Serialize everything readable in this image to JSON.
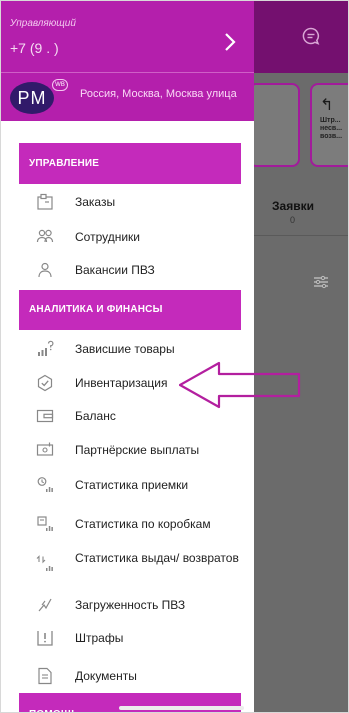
{
  "drawer": {
    "role": "Управляющий",
    "phone": "+7 (9  . )",
    "avatar_initials": "PM",
    "avatar_badge": "WB",
    "address": "Россия, Москва, Москва улица",
    "sections": {
      "management": "УПРАВЛЕНИЕ",
      "analytics": "АНАЛИТИКА И ФИНАНСЫ",
      "help": "ПОМОЩЬ"
    },
    "items": [
      {
        "label": "Заказы",
        "icon": "orders-icon"
      },
      {
        "label": "Сотрудники",
        "icon": "employees-icon"
      },
      {
        "label": "Вакансии ПВЗ",
        "icon": "vacancies-icon"
      },
      {
        "label": "Зависшие товары",
        "icon": "stuck-goods-icon"
      },
      {
        "label": "Инвентаризация",
        "icon": "inventory-icon"
      },
      {
        "label": "Баланс",
        "icon": "balance-icon"
      },
      {
        "label": "Партнёрские выплаты",
        "icon": "partner-payouts-icon"
      },
      {
        "label": "Статистика приемки",
        "icon": "acceptance-stats-icon"
      },
      {
        "label": "Статистика по коробкам",
        "icon": "box-stats-icon"
      },
      {
        "label": "Статистика выдач/ возвратов",
        "icon": "issue-return-stats-icon"
      },
      {
        "label": "Загруженность ПВЗ",
        "icon": "load-icon"
      },
      {
        "label": "Штрафы",
        "icon": "fines-icon"
      },
      {
        "label": "Документы",
        "icon": "documents-icon"
      }
    ]
  },
  "background": {
    "card_text": "Штр... несв... возв...",
    "tab_label": "Заявки",
    "tab_count": "0"
  },
  "colors": {
    "accent": "#c42abb",
    "header": "#b41fac",
    "overlay": "#6b6b6b"
  }
}
